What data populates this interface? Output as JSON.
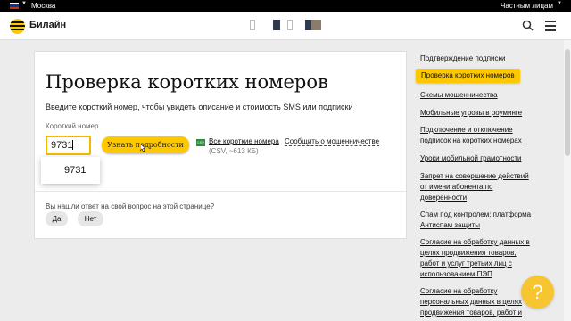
{
  "top_bar": {
    "region": "Москва",
    "audience": "Частным лицам",
    "flag_colors": [
      "#ffffff",
      "#0039a6",
      "#d52b1e"
    ]
  },
  "header": {
    "brand": "Билайн",
    "icons": [
      "beeline-logo-icon",
      "search-icon",
      "menu-icon"
    ]
  },
  "main": {
    "title": "Проверка коротких номеров",
    "description": "Введите короткий номер, чтобы увидеть описание и стоимость SMS или подписки",
    "field_label": "Короткий номер",
    "field_value": "9731",
    "suggestion": "9731",
    "submit_label": "Узнать подробности",
    "all_numbers_link": "Все короткие номера",
    "all_numbers_meta": "(CSV, ~613 КБ)",
    "report_fraud": "Сообщить о мошенничестве",
    "feedback_question": "Вы нашли ответ на свой вопрос на этой странице?",
    "yes": "Да",
    "no": "Нет"
  },
  "sidebar": {
    "items": [
      {
        "label": "Подтверждение подписки"
      },
      {
        "label": "Проверка коротких номеров",
        "active": true
      },
      {
        "label": "Схемы мошенничества"
      },
      {
        "label": "Мобильные угрозы в роуминге"
      },
      {
        "label": "Подключение и отключение подписок на коротких номерах"
      },
      {
        "label": "Уроки мобильной грамотности"
      },
      {
        "label": "Запрет на совершение действий от имени абонента по доверенности"
      },
      {
        "label": "Спам под контролем: платформа Антиспам защиты"
      },
      {
        "label": "Согласие на обработку данных в целях продвижения товаров, работ и услуг третьих лиц с использованием ПЭП"
      },
      {
        "label": "Согласие на обработку персональных данных в целях продвижения товаров, работ и услуг"
      }
    ]
  },
  "help_button": "?",
  "colors": {
    "accent": "#fec800",
    "text": "#1a1a1a",
    "background": "#ececec"
  }
}
